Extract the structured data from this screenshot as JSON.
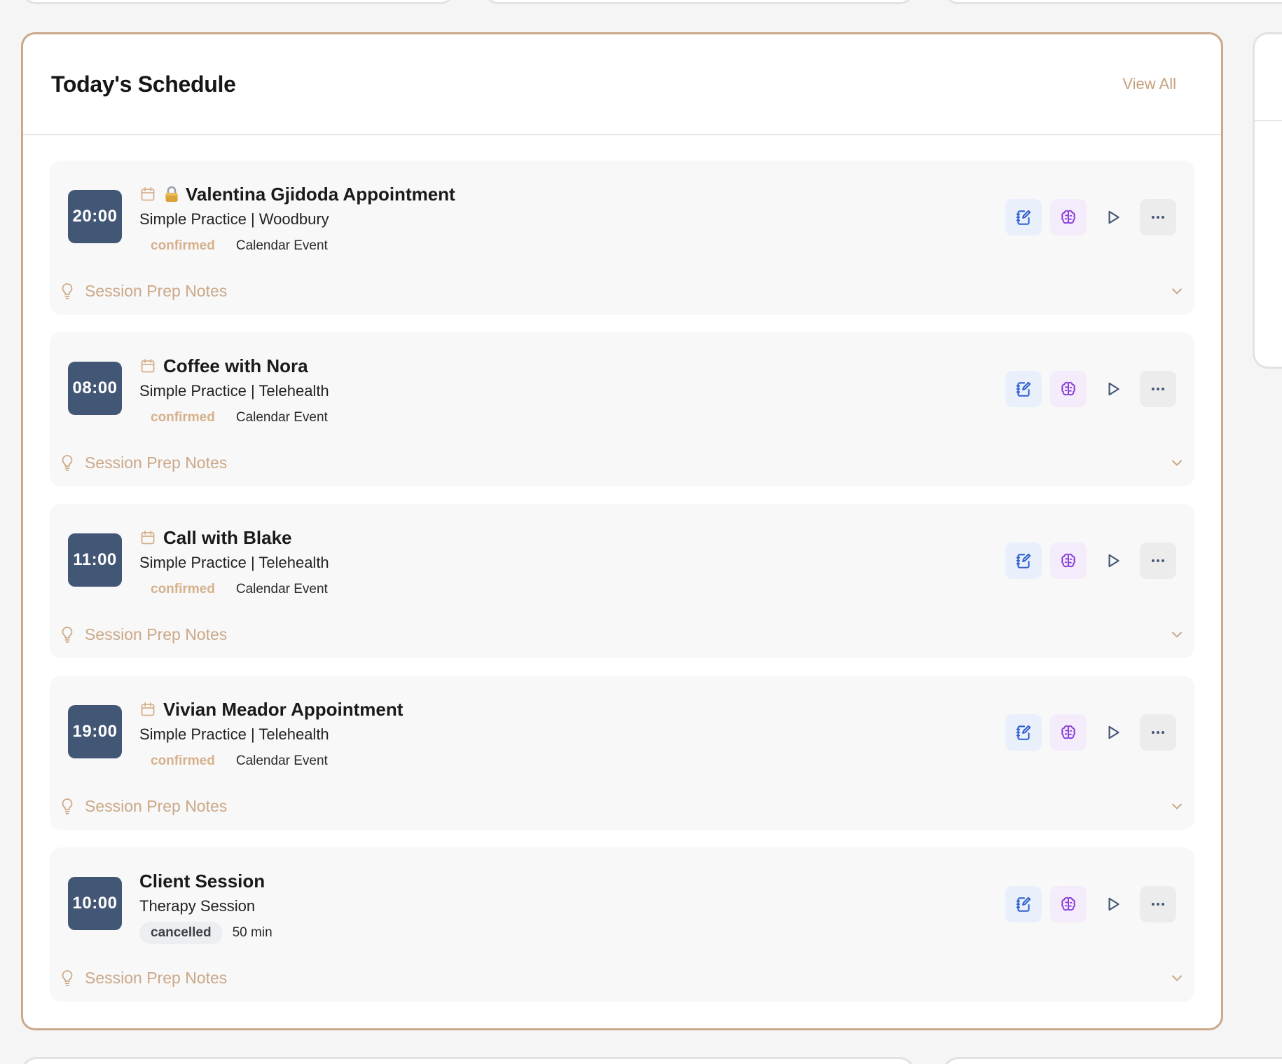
{
  "schedule": {
    "title": "Today's Schedule",
    "view_all_label": "View All",
    "prep_label": "Session Prep Notes",
    "colors": {
      "accent": "#c4a07e",
      "time_badge": "#425675",
      "card_border": "#c9a98a",
      "notes_icon": "#2f5fd0",
      "brain_icon": "#8b3fd9"
    },
    "items": [
      {
        "time": "20:00",
        "title": "Valentina Gjidoda Appointment",
        "subtitle": "Simple Practice | Woodbury",
        "status": "confirmed",
        "meta": "Calendar Event",
        "calendar_icon": true,
        "lock_icon": true
      },
      {
        "time": "08:00",
        "title": "Coffee with Nora",
        "subtitle": "Simple Practice | Telehealth",
        "status": "confirmed",
        "meta": "Calendar Event",
        "calendar_icon": true,
        "lock_icon": false
      },
      {
        "time": "11:00",
        "title": "Call with Blake",
        "subtitle": "Simple Practice | Telehealth",
        "status": "confirmed",
        "meta": "Calendar Event",
        "calendar_icon": true,
        "lock_icon": false
      },
      {
        "time": "19:00",
        "title": "Vivian Meador Appointment",
        "subtitle": "Simple Practice | Telehealth",
        "status": "confirmed",
        "meta": "Calendar Event",
        "calendar_icon": true,
        "lock_icon": false
      },
      {
        "time": "10:00",
        "title": "Client Session",
        "subtitle": "Therapy Session",
        "status": "cancelled",
        "meta": "50 min",
        "calendar_icon": false,
        "lock_icon": false
      }
    ],
    "action_icons": [
      "notes-icon",
      "brain-icon",
      "play-icon",
      "more-icon"
    ]
  }
}
